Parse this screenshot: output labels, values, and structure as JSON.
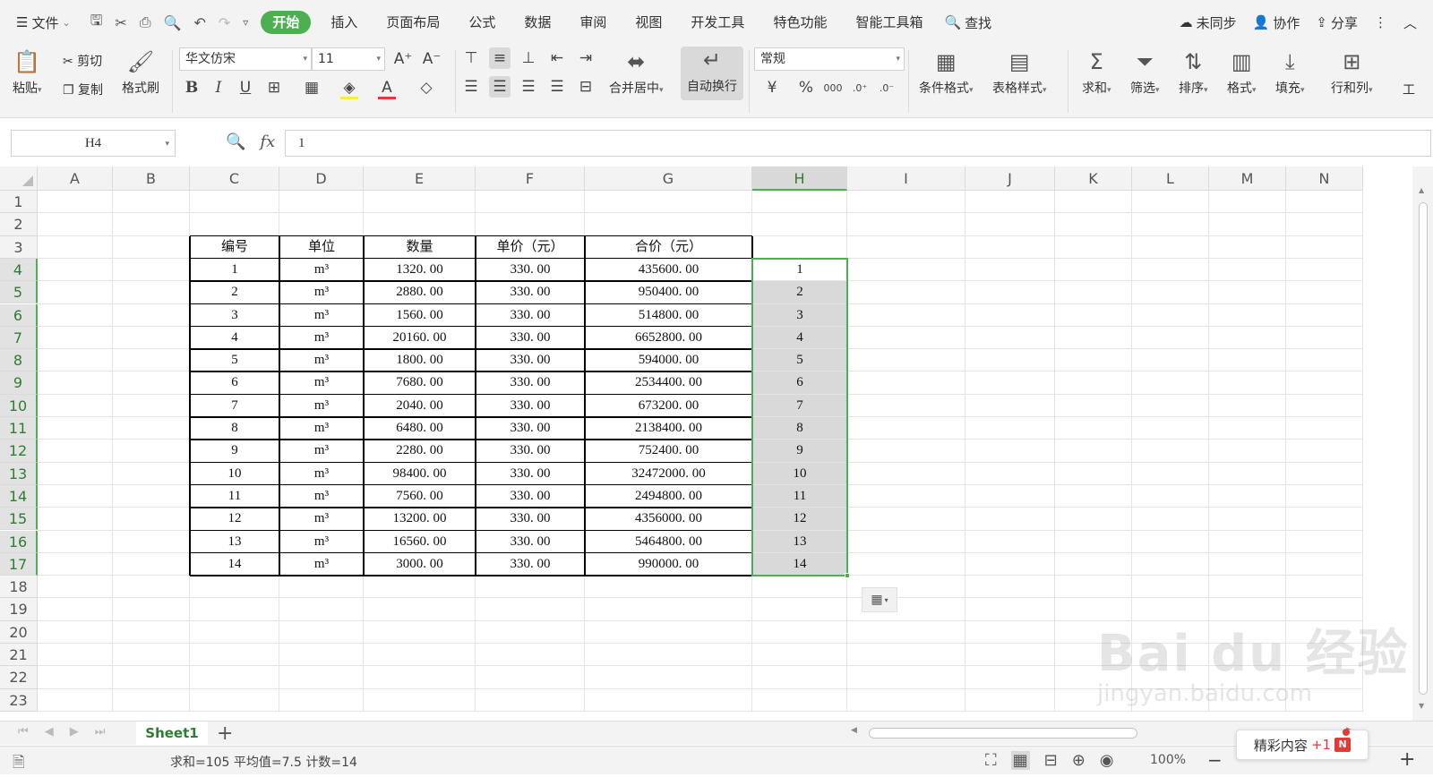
{
  "menubar": {
    "file_label": "文件",
    "tabs": [
      "开始",
      "插入",
      "页面布局",
      "公式",
      "数据",
      "审阅",
      "视图",
      "开发工具",
      "特色功能",
      "智能工具箱"
    ],
    "search_label": "查找",
    "sync_label": "未同步",
    "collab_label": "协作",
    "share_label": "分享"
  },
  "ribbon": {
    "paste": "粘贴",
    "cut": "剪切",
    "copy": "复制",
    "format_painter": "格式刷",
    "font_name": "华文仿宋",
    "font_size": "11",
    "bold": "B",
    "italic": "I",
    "underline": "U",
    "merge_center": "合并居中",
    "wrap_text": "自动换行",
    "number_format": "常规",
    "conditional_format": "条件格式",
    "table_style": "表格样式",
    "sum": "求和",
    "filter": "筛选",
    "sort": "排序",
    "format": "格式",
    "fill": "填充",
    "row_col": "行和列",
    "worksheet": "工",
    "font_color": "#e53935",
    "fill_color": "#ffeb3b"
  },
  "formula_bar": {
    "name_box": "H4",
    "fx": "fx",
    "content": "1"
  },
  "columns": [
    "A",
    "B",
    "C",
    "D",
    "E",
    "F",
    "G",
    "H",
    "I",
    "J",
    "K",
    "L",
    "M",
    "N"
  ],
  "rows": [
    "1",
    "2",
    "3",
    "4",
    "5",
    "6",
    "7",
    "8",
    "9",
    "10",
    "11",
    "12",
    "13",
    "14",
    "15",
    "16",
    "17",
    "18",
    "19",
    "20",
    "21",
    "22",
    "23"
  ],
  "table": {
    "headers": [
      "编号",
      "单位",
      "数量",
      "单价（元）",
      "合价（元）"
    ],
    "rows": [
      [
        "1",
        "m³",
        "1320. 00",
        "330. 00",
        "435600. 00",
        "1"
      ],
      [
        "2",
        "m³",
        "2880. 00",
        "330. 00",
        "950400. 00",
        "2"
      ],
      [
        "3",
        "m³",
        "1560. 00",
        "330. 00",
        "514800. 00",
        "3"
      ],
      [
        "4",
        "m³",
        "20160. 00",
        "330. 00",
        "6652800. 00",
        "4"
      ],
      [
        "5",
        "m³",
        "1800. 00",
        "330. 00",
        "594000. 00",
        "5"
      ],
      [
        "6",
        "m³",
        "7680. 00",
        "330. 00",
        "2534400. 00",
        "6"
      ],
      [
        "7",
        "m³",
        "2040. 00",
        "330. 00",
        "673200. 00",
        "7"
      ],
      [
        "8",
        "m³",
        "6480. 00",
        "330. 00",
        "2138400. 00",
        "8"
      ],
      [
        "9",
        "m³",
        "2280. 00",
        "330. 00",
        "752400. 00",
        "9"
      ],
      [
        "10",
        "m³",
        "98400. 00",
        "330. 00",
        "32472000. 00",
        "10"
      ],
      [
        "11",
        "m³",
        "7560. 00",
        "330. 00",
        "2494800. 00",
        "11"
      ],
      [
        "12",
        "m³",
        "13200. 00",
        "330. 00",
        "4356000. 00",
        "12"
      ],
      [
        "13",
        "m³",
        "16560. 00",
        "330. 00",
        "5464800. 00",
        "13"
      ],
      [
        "14",
        "m³",
        "3000. 00",
        "330. 00",
        "990000. 00",
        "14"
      ]
    ]
  },
  "sheet": {
    "tab_name": "Sheet1",
    "add": "+"
  },
  "status": {
    "summary": "求和=105  平均值=7.5  计数=14",
    "zoom": "100%"
  },
  "popup": {
    "label": "精彩内容",
    "plus": "+1",
    "badge": "N"
  },
  "watermark": {
    "brand": "Bai du 经验",
    "url": "jingyan.baidu.com"
  },
  "colors": {
    "accent": "#4caf50",
    "selection": "#d9d9d9"
  }
}
